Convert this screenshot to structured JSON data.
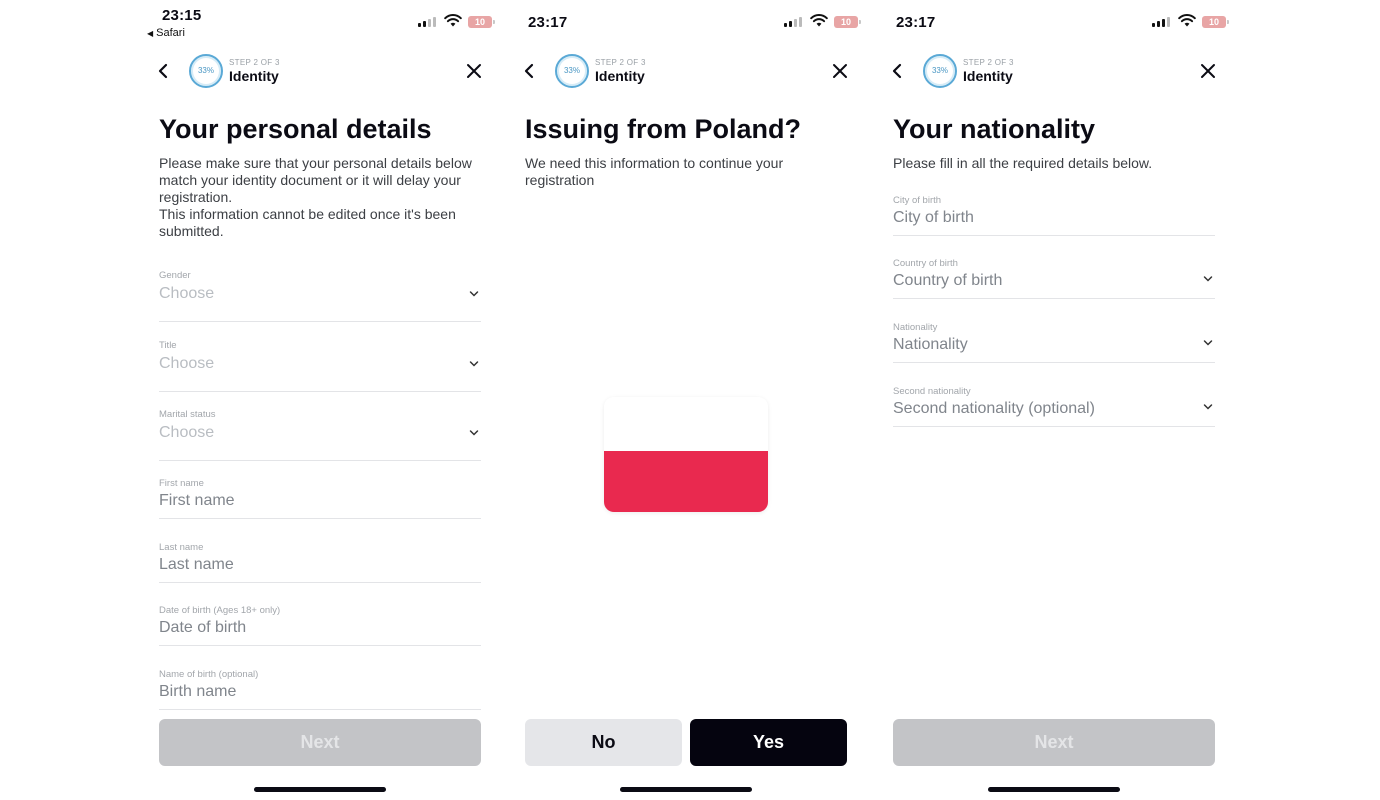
{
  "colors": {
    "accent_ring": "#5aa9d6",
    "button_disabled": "#c3c4c7",
    "button_primary": "#05040f",
    "button_secondary": "#e5e6e9",
    "flag_white": "#ffffff",
    "flag_red": "#e9294f",
    "battery": "#e8a5a5"
  },
  "screens": [
    {
      "status": {
        "time": "23:15",
        "back_app": "Safari",
        "battery": "10"
      },
      "header": {
        "progress": "33%",
        "step": "STEP 2 OF 3",
        "title": "Identity"
      },
      "heading": "Your personal details",
      "subtext": [
        "Please make sure that your personal details below match your identity document or it will delay your registration.",
        "This information cannot be edited once it's been submitted."
      ],
      "fields": [
        {
          "label": "Gender",
          "value": "Choose",
          "type": "select"
        },
        {
          "label": "Title",
          "value": "Choose",
          "type": "select"
        },
        {
          "label": "Marital status",
          "value": "Choose",
          "type": "select"
        },
        {
          "label": "First name",
          "value": "First name",
          "type": "text"
        },
        {
          "label": "Last name",
          "value": "Last name",
          "type": "text"
        },
        {
          "label": "Date of birth (Ages 18+ only)",
          "value": "Date of birth",
          "type": "text"
        },
        {
          "label": "Name of birth (optional)",
          "value": "Birth name",
          "type": "text"
        }
      ],
      "button": "Next"
    },
    {
      "status": {
        "time": "23:17",
        "battery": "10"
      },
      "header": {
        "progress": "33%",
        "step": "STEP 2 OF 3",
        "title": "Identity"
      },
      "heading": "Issuing from Poland?",
      "subtext": [
        "We need this information to continue your registration"
      ],
      "flag_icon": "poland-flag-icon",
      "buttons": {
        "no": "No",
        "yes": "Yes"
      }
    },
    {
      "status": {
        "time": "23:17",
        "battery": "10"
      },
      "header": {
        "progress": "33%",
        "step": "STEP 2 OF 3",
        "title": "Identity"
      },
      "heading": "Your nationality",
      "subtext": [
        "Please fill in all the required details below."
      ],
      "fields": [
        {
          "label": "City of birth",
          "value": "City of birth",
          "type": "text"
        },
        {
          "label": "Country of birth",
          "value": "Country of birth",
          "type": "select"
        },
        {
          "label": "Nationality",
          "value": "Nationality",
          "type": "select"
        },
        {
          "label": "Second nationality",
          "value": "Second nationality (optional)",
          "type": "select"
        }
      ],
      "button": "Next"
    }
  ]
}
